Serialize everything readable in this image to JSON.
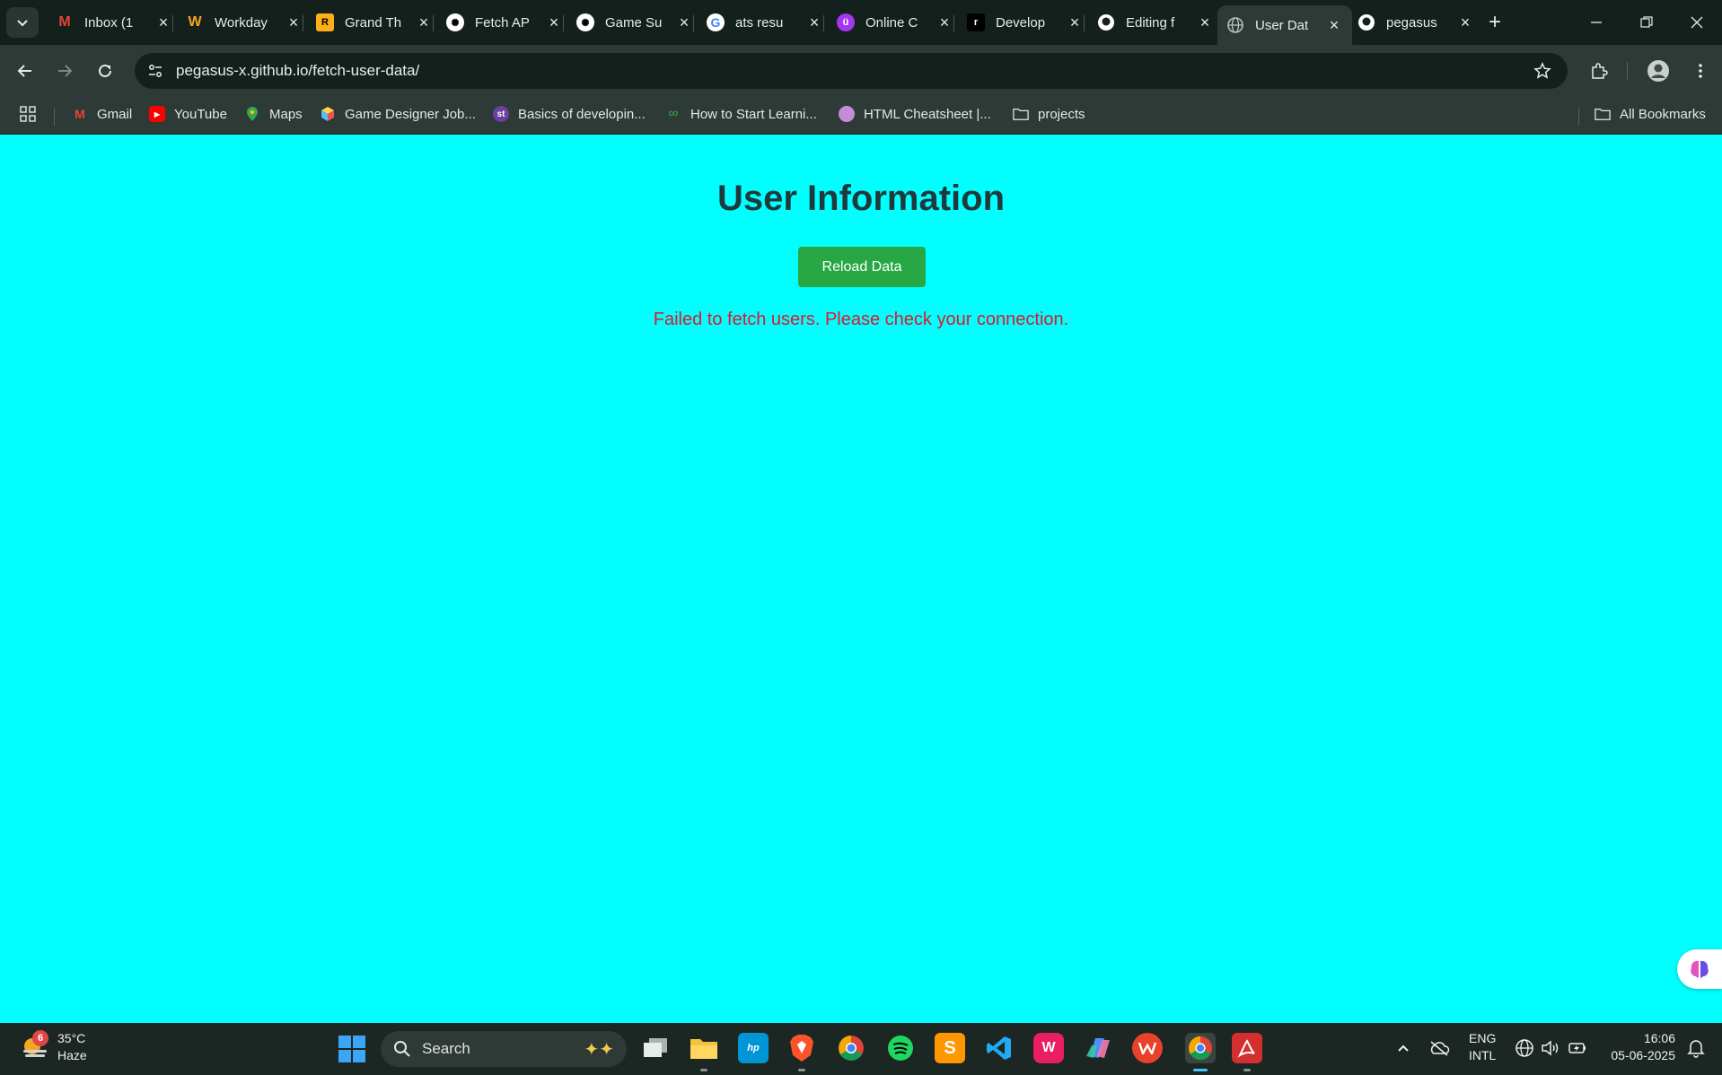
{
  "browser": {
    "tabs": [
      {
        "title": "Inbox (1",
        "icon": "gmail-icon",
        "color": "#ea4335",
        "glyph": "M"
      },
      {
        "title": "Workday",
        "icon": "workday-icon",
        "color": "#f5a623",
        "glyph": "W"
      },
      {
        "title": "Grand Th",
        "icon": "rockstar-icon",
        "color": "#fcaf17",
        "glyph": "R"
      },
      {
        "title": "Fetch AP",
        "icon": "openai-icon",
        "color": "#ffffff",
        "glyph": "✺"
      },
      {
        "title": "Game Su",
        "icon": "openai-icon",
        "color": "#ffffff",
        "glyph": "✺"
      },
      {
        "title": "ats resu",
        "icon": "google-icon",
        "color": "#ffffff",
        "glyph": "G"
      },
      {
        "title": "Online C",
        "icon": "udemy-icon",
        "color": "#a435f0",
        "glyph": "ü"
      },
      {
        "title": "Develop",
        "icon": "render-icon",
        "color": "#000000",
        "glyph": "r"
      },
      {
        "title": "Editing f",
        "icon": "github-icon",
        "color": "#ffffff",
        "glyph": "●"
      },
      {
        "title": "User Dat",
        "icon": "globe-icon",
        "color": "#9aa5a1",
        "glyph": "◍",
        "active": true
      },
      {
        "title": "pegasus",
        "icon": "github-icon",
        "color": "#ffffff",
        "glyph": "●"
      }
    ],
    "url": "pegasus-x.github.io/fetch-user-data/"
  },
  "bookmarks": [
    {
      "label": "Gmail",
      "icon": "gmail-icon",
      "color": "#ea4335",
      "glyph": "M"
    },
    {
      "label": "YouTube",
      "icon": "youtube-icon",
      "color": "#ff0000",
      "glyph": "▶"
    },
    {
      "label": "Maps",
      "icon": "maps-icon",
      "color": "#34a853",
      "glyph": "●"
    },
    {
      "label": "Game Designer Job...",
      "icon": "cube-icon",
      "color": "#4fc3f7",
      "glyph": "◆"
    },
    {
      "label": "Basics of developin...",
      "icon": "st-icon",
      "color": "#6b3fa0",
      "glyph": "st"
    },
    {
      "label": "How to Start Learni...",
      "icon": "geeksforgeeks-icon",
      "color": "#2f8d46",
      "glyph": "∞"
    },
    {
      "label": "HTML Cheatsheet |...",
      "icon": "avatar-icon",
      "color": "#c48bd6",
      "glyph": "●"
    },
    {
      "label": "projects",
      "icon": "folder-icon",
      "color": "none",
      "glyph": ""
    }
  ],
  "all_bookmarks_label": "All Bookmarks",
  "page": {
    "heading": "User Information",
    "reload_button": "Reload Data",
    "error": "Failed to fetch users. Please check your connection.",
    "background_color": "#00ffff",
    "button_color": "#28a745",
    "error_color": "#e0182b"
  },
  "taskbar": {
    "weather_badge": "6",
    "temperature": "35°C",
    "condition": "Haze",
    "search_label": "Search",
    "language_top": "ENG",
    "language_bottom": "INTL",
    "time": "16:06",
    "date": "05-06-2025"
  }
}
